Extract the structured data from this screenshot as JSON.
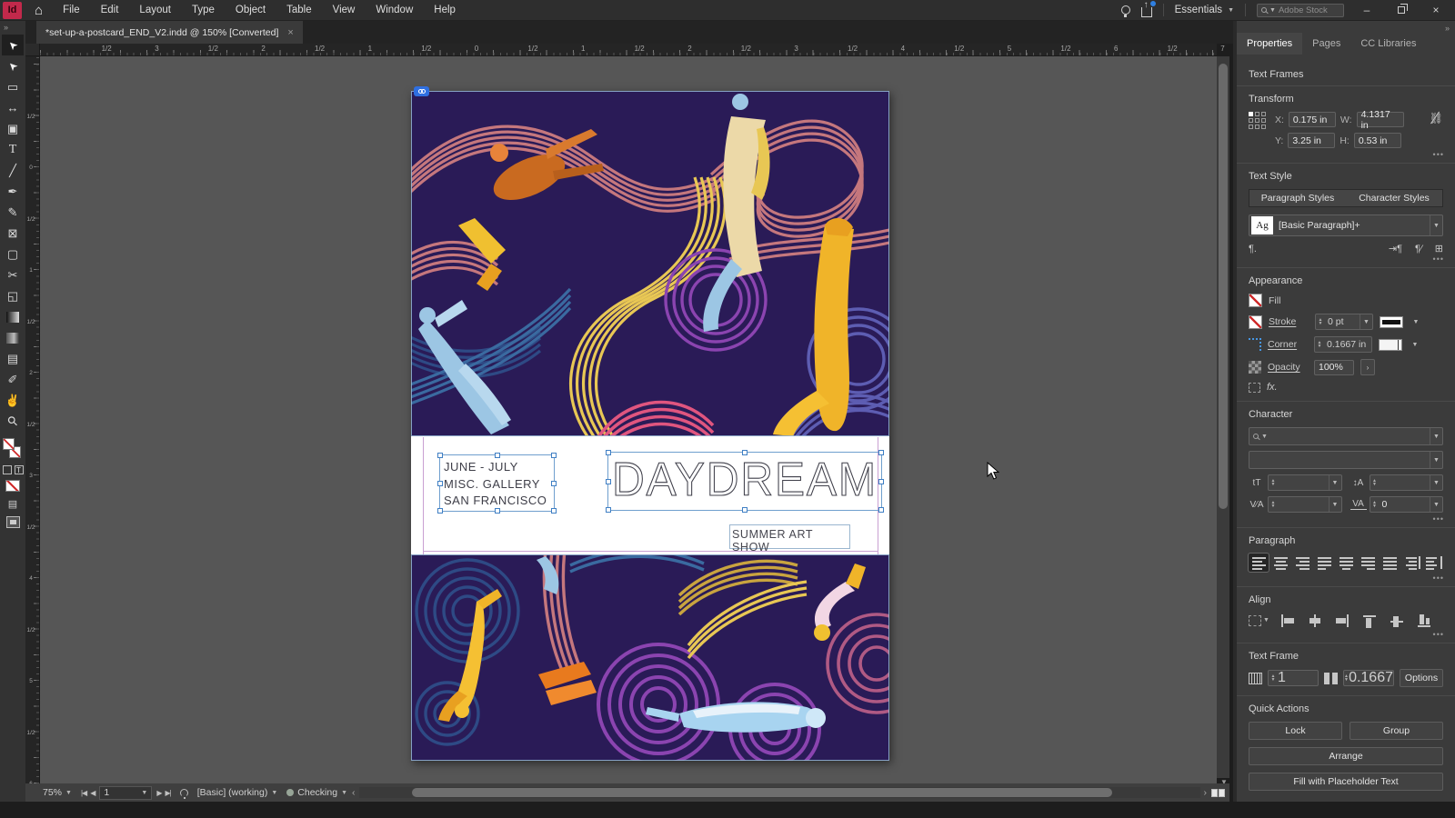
{
  "titlebar": {
    "logo": "Id",
    "menu": [
      "File",
      "Edit",
      "Layout",
      "Type",
      "Object",
      "Table",
      "View",
      "Window",
      "Help"
    ],
    "workspace": "Essentials",
    "search_placeholder": "Adobe Stock",
    "minimize": "–",
    "close": "×"
  },
  "doc_tab": {
    "title": "*set-up-a-postcard_END_V2.indd @ 150% [Converted]",
    "close": "×"
  },
  "dock": {
    "collapse": "»"
  },
  "toolbar": [
    {
      "name": "selection-tool",
      "glyph": "➤",
      "state": "active"
    },
    {
      "name": "direct-selection-tool",
      "glyph": "➤"
    },
    {
      "name": "page-tool",
      "glyph": "▭"
    },
    {
      "name": "gap-tool",
      "glyph": "↔"
    },
    {
      "name": "content-collector-tool",
      "glyph": "▣"
    },
    {
      "name": "type-tool",
      "glyph": "T"
    },
    {
      "name": "line-tool",
      "glyph": "╱"
    },
    {
      "name": "pen-tool",
      "glyph": "✒"
    },
    {
      "name": "pencil-tool",
      "glyph": "✎"
    },
    {
      "name": "frame-tool",
      "glyph": "⊠"
    },
    {
      "name": "rectangle-tool",
      "glyph": "▢"
    },
    {
      "name": "scissors-tool",
      "glyph": "✂"
    },
    {
      "name": "free-transform-tool",
      "glyph": "◱"
    },
    {
      "name": "gradient-tool",
      "glyph": ""
    },
    {
      "name": "gradient-feather-tool",
      "glyph": ""
    },
    {
      "name": "note-tool",
      "glyph": "▤"
    },
    {
      "name": "eyedropper-tool",
      "glyph": "✐"
    },
    {
      "name": "hand-tool",
      "glyph": "✌"
    },
    {
      "name": "zoom-tool",
      "glyph": "⚲"
    }
  ],
  "rulers": {
    "h": [
      "1/2",
      "3",
      "1/2",
      "2",
      "1/2",
      "1",
      "1/2",
      "0",
      "1/2",
      "1",
      "1/2",
      "2",
      "1/2",
      "3",
      "1/2",
      "4",
      "1/2",
      "5",
      "1/2",
      "6",
      "1/2",
      "7"
    ],
    "v": [
      "1/2",
      "0",
      "1/2",
      "1",
      "1/2",
      "2",
      "1/2",
      "3",
      "1/2",
      "4",
      "1/2",
      "5",
      "1/2",
      "6"
    ]
  },
  "document": {
    "postcard": {
      "dates": "JUNE - JULY",
      "gallery": "MISC. GALLERY",
      "city": "SAN FRANCISCO",
      "title": "DAYDREAM",
      "subtitle": "SUMMER ART SHOW"
    },
    "artwork_palette": {
      "background": "#2a1b57",
      "salmon": "#c5777d",
      "yellow": "#e8c754",
      "purple": "#8b44b0",
      "magenta": "#e0557f",
      "blue": "#3a6aa0",
      "navy": "#2e4a85",
      "indigo": "#5d5db2",
      "mauve": "#b05a84",
      "orange": "#d97a2e",
      "cream": "#ecd9a8",
      "light_blue": "#9cc6e4",
      "bright_yellow": "#f0b429"
    }
  },
  "statusbar": {
    "zoom": "75%",
    "first": "|◀",
    "prev": "◀",
    "page": "1",
    "next": "▶",
    "last": "▶|",
    "preset": "[Basic] (working)",
    "preflight_status": "Checking",
    "scroll_left": "‹",
    "scroll_right": "›"
  },
  "panel": {
    "collapse": "»",
    "tabs": [
      {
        "label": "Properties",
        "state": "on"
      },
      {
        "label": "Pages"
      },
      {
        "label": "CC Libraries"
      }
    ],
    "selection_label": "Text Frames",
    "transform": {
      "title": "Transform",
      "x_label": "X:",
      "x": "0.175 in",
      "y_label": "Y:",
      "y": "3.25 in",
      "w_label": "W:",
      "w": "4.1317 in",
      "h_label": "H:",
      "h": "0.53 in",
      "more": "•••"
    },
    "text_style": {
      "title": "Text Style",
      "tabs": [
        "Paragraph Styles",
        "Character Styles"
      ],
      "ag": "Ag",
      "style_name": "[Basic Paragraph]+",
      "para_mark": "¶.",
      "more": "•••"
    },
    "appearance": {
      "title": "Appearance",
      "fill_label": "Fill",
      "stroke_label": "Stroke",
      "stroke_value": "0 pt",
      "corner_label": "Corner",
      "corner_value": "0.1667 in",
      "opacity_label": "Opacity",
      "opacity_value": "100%",
      "opacity_more": "›",
      "fx_label": "fx."
    },
    "character": {
      "title": "Character",
      "font_size_icon": "tT",
      "leading_icon": "↕A",
      "kerning_icon": "V⁄A",
      "tracking_icon": "VA",
      "tracking_value": "0",
      "more": "•••"
    },
    "paragraph": {
      "title": "Paragraph",
      "buttons": [
        {
          "name": "paragraph-align-left",
          "state": "active"
        },
        {
          "name": "paragraph-align-center"
        },
        {
          "name": "paragraph-align-right"
        },
        {
          "name": "paragraph-justify-left"
        },
        {
          "name": "paragraph-justify-center"
        },
        {
          "name": "paragraph-justify-right"
        },
        {
          "name": "paragraph-justify-all"
        },
        {
          "name": "paragraph-align-toward-spine"
        },
        {
          "name": "paragraph-align-away-spine"
        }
      ],
      "more": "•••"
    },
    "align": {
      "title": "Align",
      "buttons": [
        {
          "name": "align-left-button"
        },
        {
          "name": "align-center-h-button"
        },
        {
          "name": "align-right-button"
        },
        {
          "name": "align-top-button"
        },
        {
          "name": "align-center-v-button"
        },
        {
          "name": "align-bottom-button"
        }
      ],
      "more": "•••"
    },
    "text_frame": {
      "title": "Text Frame",
      "columns": "1",
      "gutter": "0.1667",
      "options": "Options"
    },
    "quick_actions": {
      "title": "Quick Actions",
      "lock": "Lock",
      "group": "Group",
      "arrange": "Arrange",
      "fill_placeholder": "Fill with Placeholder Text"
    }
  }
}
